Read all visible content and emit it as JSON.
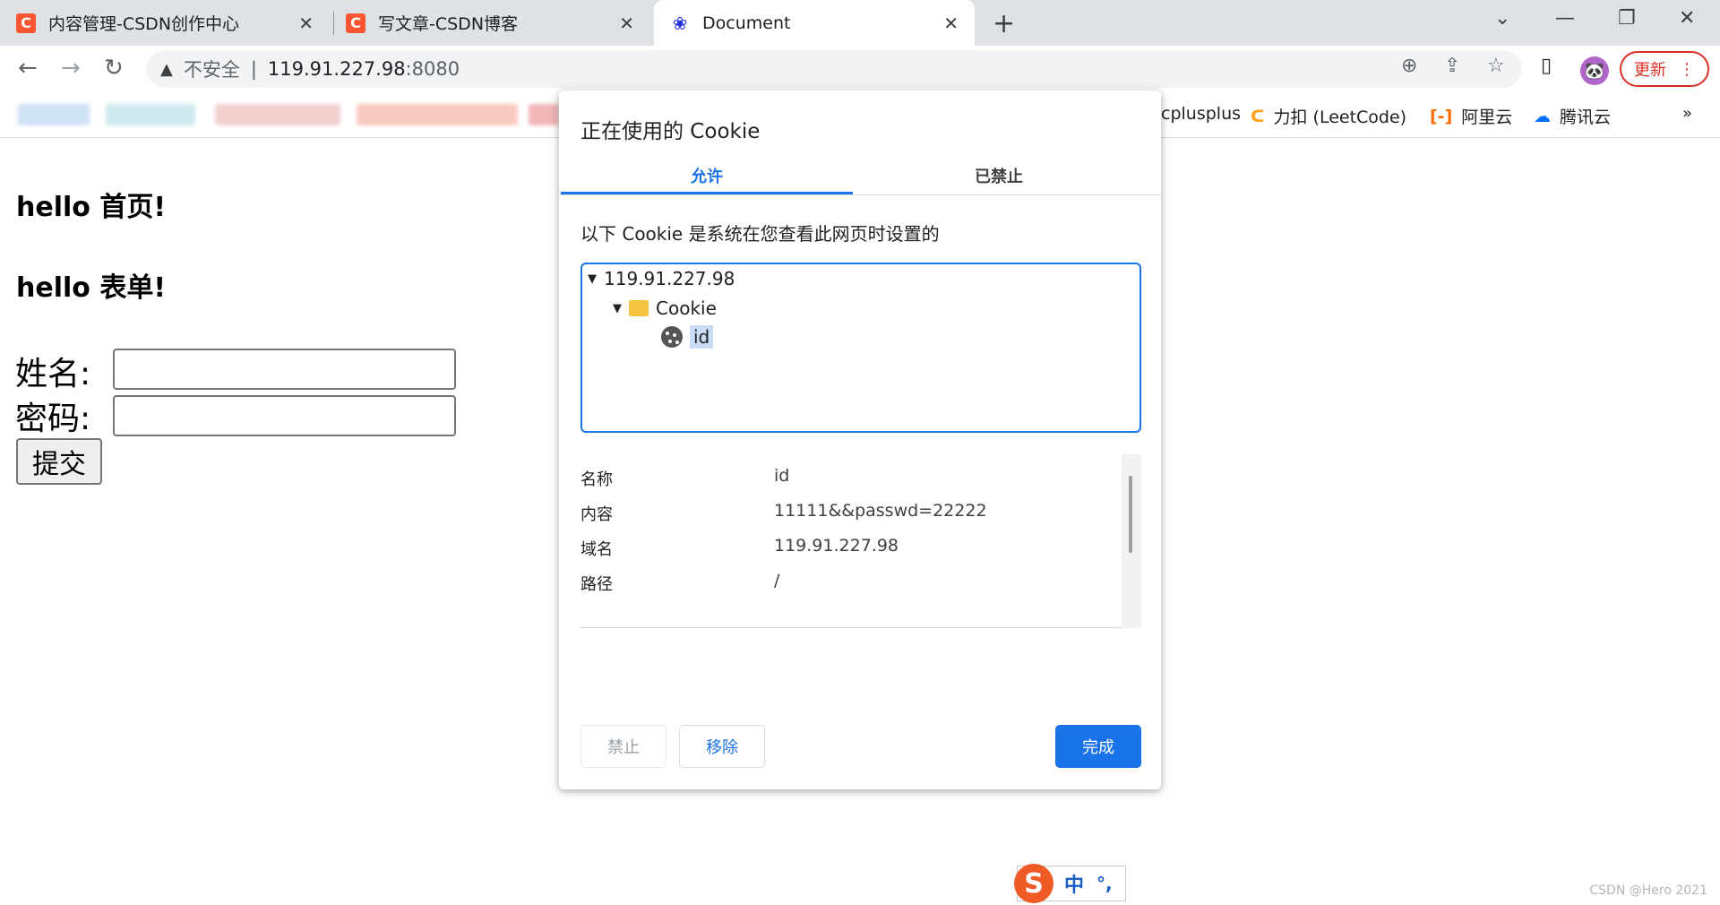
{
  "tabs": [
    {
      "title": "内容管理-CSDN创作中心",
      "favicon": "C"
    },
    {
      "title": "写文章-CSDN博客",
      "favicon": "C"
    },
    {
      "title": "Document",
      "favicon": "baidu-paw"
    }
  ],
  "window_controls": {
    "dropdown": "⌄",
    "minimize": "—",
    "restore": "❐",
    "close": "✕"
  },
  "toolbar": {
    "security_label": "不安全",
    "url_host": "119.91.227.98",
    "url_port": ":8080",
    "update_label": "更新"
  },
  "bookmarks": [
    {
      "label": "cplusplus"
    },
    {
      "label": "力扣 (LeetCode)"
    },
    {
      "label": "阿里云"
    },
    {
      "label": "腾讯云"
    }
  ],
  "page": {
    "heading1": "hello 首页!",
    "heading2": "hello 表单!",
    "name_label": "姓名:",
    "password_label": "密码:",
    "submit_label": "提交"
  },
  "cookie_dialog": {
    "title": "正在使用的 Cookie",
    "tab_allowed": "允许",
    "tab_blocked": "已禁止",
    "description": "以下 Cookie 是系统在您查看此网页时设置的",
    "tree": {
      "host": "119.91.227.98",
      "folder": "Cookie",
      "item": "id"
    },
    "details": [
      {
        "key": "名称",
        "value": "id"
      },
      {
        "key": "内容",
        "value": "11111&&passwd=22222"
      },
      {
        "key": "域名",
        "value": "119.91.227.98"
      },
      {
        "key": "路径",
        "value": "/"
      }
    ],
    "buttons": {
      "block": "禁止",
      "remove": "移除",
      "done": "完成"
    }
  },
  "ime": {
    "logo": "S",
    "mode": "中",
    "punct": "°,"
  },
  "watermark": "CSDN @Hero 2021",
  "colors": {
    "accent": "#1a73e8",
    "csdn": "#fc5531",
    "update": "#d93025"
  }
}
